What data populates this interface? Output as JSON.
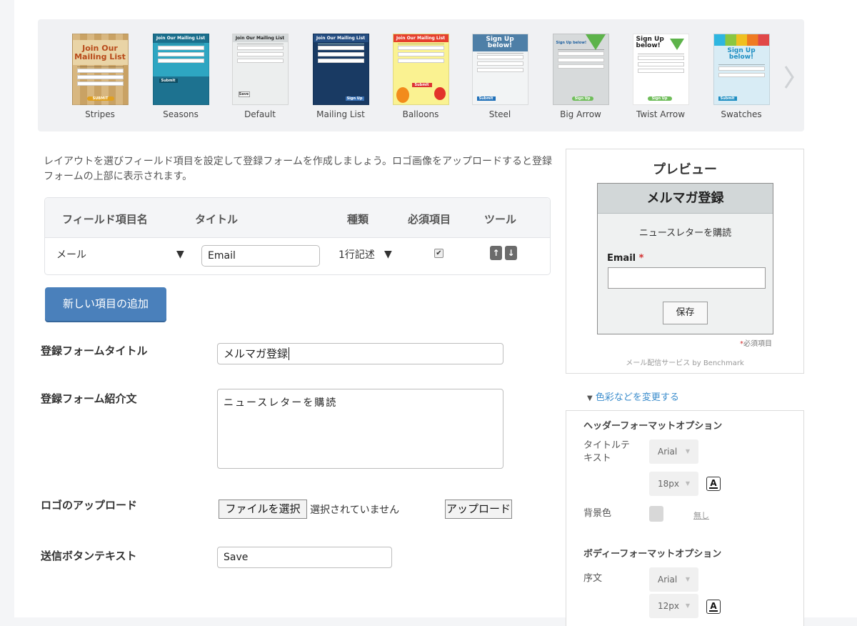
{
  "templates": [
    {
      "name": "Stripes",
      "thumb_title": "Join Our Mailing List",
      "button": "SUBMIT"
    },
    {
      "name": "Seasons",
      "thumb_title": "Join Our Mailing List",
      "button": "Submit"
    },
    {
      "name": "Default",
      "thumb_title": "Join Our Mailing List",
      "button": "Save"
    },
    {
      "name": "Mailing List",
      "thumb_title": "Join Our Mailing List",
      "button": "Sign Up"
    },
    {
      "name": "Balloons",
      "thumb_title": "Join Our Mailing List",
      "button": "Submit"
    },
    {
      "name": "Steel",
      "thumb_title": "Sign Up below!",
      "button": "Submit"
    },
    {
      "name": "Big Arrow",
      "thumb_title": "Sign Up below!",
      "button": "Sign Up"
    },
    {
      "name": "Twist Arrow",
      "thumb_title": "Sign Up below!",
      "button": "Sign Up"
    },
    {
      "name": "Swatches",
      "thumb_title": "Sign Up below!",
      "button": "Submit"
    }
  ],
  "intro": "レイアウトを選びフィールド項目を設定して登録フォームを作成しましょう。ロゴ画像をアップロードすると登録フォームの上部に表示されます。",
  "field_table": {
    "headers": [
      "フィールド項目名",
      "タイトル",
      "種類",
      "必須項目",
      "ツール"
    ],
    "row": {
      "field_name": "メール",
      "title_value": "Email",
      "type": "1行記述",
      "required": true,
      "move_up_icon": "arrow-up-icon",
      "move_down_icon": "arrow-down-icon"
    }
  },
  "add_button": "新しい項目の追加",
  "form_title": {
    "label": "登録フォームタイトル",
    "value": "メルマガ登録"
  },
  "form_intro": {
    "label": "登録フォーム紹介文",
    "value": "ニュースレターを購読"
  },
  "logo_upload": {
    "label": "ロゴのアップロード",
    "choose_button": "ファイルを選択",
    "status": "選択されていません",
    "upload_button": "アップロード"
  },
  "submit_text": {
    "label": "送信ボタンテキスト",
    "value": "Save"
  },
  "preview": {
    "heading": "プレビュー",
    "form_title": "メルマガ登録",
    "form_desc": "ニュースレターを購読",
    "email_label": "Email",
    "required_mark": "*",
    "save_button": "保存",
    "required_note": "必須項目",
    "service_note": "メール配信サービス by Benchmark"
  },
  "customize_link": "色彩などを変更する",
  "options": {
    "header_section": "ヘッダーフォーマットオプション",
    "title_text_label": "タイトルテキスト",
    "title_font": "Arial",
    "title_size": "18px",
    "bg_color_label": "背景色",
    "bg_none": "無し",
    "body_section": "ボディーフォーマットオプション",
    "intro_label": "序文",
    "body_font": "Arial",
    "body_size": "12px"
  },
  "colors": {
    "accent": "#4a80bb",
    "link": "#3a8ccc",
    "required": "#d32f2f"
  }
}
